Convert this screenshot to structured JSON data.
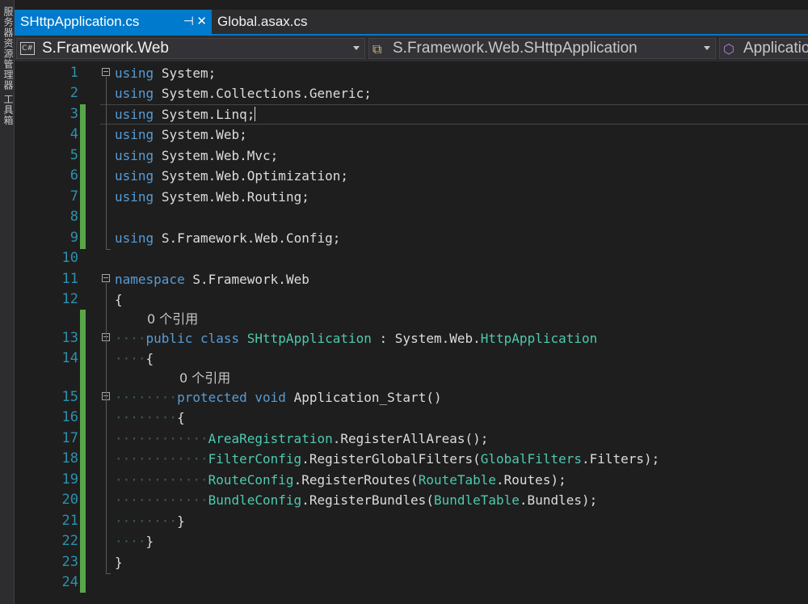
{
  "sidebar": {
    "vertical_text": "服务器资源管理器  工具箱"
  },
  "tabs": [
    {
      "label": "SHttpApplication.cs",
      "active": true,
      "pin_icon": "pin-icon",
      "close_icon": "close-icon"
    },
    {
      "label": "Global.asax.cs",
      "active": false
    }
  ],
  "navigation": {
    "project": {
      "icon": "C#",
      "label": "S.Framework.Web"
    },
    "type": {
      "icon": "class-icon",
      "label": "S.Framework.Web.SHttpApplication"
    },
    "member": {
      "icon": "method-icon",
      "label": "Applicatio"
    }
  },
  "editor": {
    "lines": [
      {
        "num": "1",
        "text": "using System;"
      },
      {
        "num": "2",
        "text": "using System.Collections.Generic;"
      },
      {
        "num": "3",
        "text": "using System.Linq;"
      },
      {
        "num": "4",
        "text": "using System.Web;"
      },
      {
        "num": "5",
        "text": "using System.Web.Mvc;"
      },
      {
        "num": "6",
        "text": "using System.Web.Optimization;"
      },
      {
        "num": "7",
        "text": "using System.Web.Routing;"
      },
      {
        "num": "8",
        "text": ""
      },
      {
        "num": "9",
        "text": "using S.Framework.Web.Config;"
      },
      {
        "num": "10",
        "text": ""
      },
      {
        "num": "11",
        "text": "namespace S.Framework.Web"
      },
      {
        "num": "12",
        "text": "{"
      },
      {
        "num": "13",
        "text": "public class SHttpApplication : System.Web.HttpApplication"
      },
      {
        "num": "14",
        "text": "{"
      },
      {
        "num": "15",
        "text": "protected void Application_Start()"
      },
      {
        "num": "16",
        "text": "{"
      },
      {
        "num": "17",
        "text": "AreaRegistration.RegisterAllAreas();"
      },
      {
        "num": "18",
        "text": "FilterConfig.RegisterGlobalFilters(GlobalFilters.Filters);"
      },
      {
        "num": "19",
        "text": "RouteConfig.RegisterRoutes(RouteTable.Routes);"
      },
      {
        "num": "20",
        "text": "BundleConfig.RegisterBundles(BundleTable.Bundles);"
      },
      {
        "num": "21",
        "text": "}"
      },
      {
        "num": "22",
        "text": "}"
      },
      {
        "num": "23",
        "text": "}"
      },
      {
        "num": "24",
        "text": ""
      }
    ],
    "codelens": [
      {
        "before_line": "13",
        "text": "0 个引用"
      },
      {
        "before_line": "15",
        "text": "0 个引用"
      }
    ],
    "current_line": "3",
    "colors": {
      "keyword": "#569cd6",
      "type": "#4ec9b0",
      "text": "#dcdcdc",
      "line_number": "#2b91af",
      "change_marker": "#57a64a",
      "accent": "#007acc"
    }
  }
}
